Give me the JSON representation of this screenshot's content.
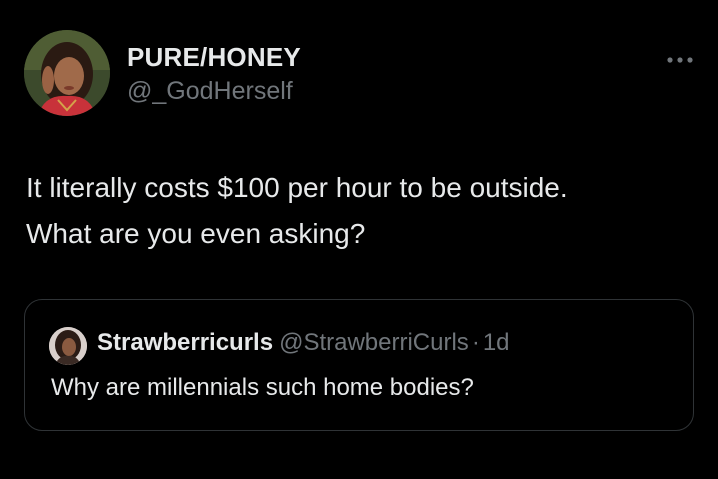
{
  "tweet": {
    "author": {
      "display_name": "PURE/HONEY",
      "handle": "@_GodHerself",
      "avatar_icon": "profile-photo"
    },
    "more_icon": "ellipsis-horizontal-icon",
    "text_lines": [
      "It literally costs $100 per hour to be outside.",
      "What are you even asking?"
    ]
  },
  "quote": {
    "author": {
      "display_name": "Strawberricurls",
      "handle": "@StrawberriCurls",
      "avatar_icon": "profile-photo"
    },
    "separator": "·",
    "time": "1d",
    "text": "Why are millennials such home bodies?"
  },
  "colors": {
    "background": "#000000",
    "primary_text": "#e7e9ea",
    "secondary_text": "#71767b",
    "border": "#2f3336"
  }
}
